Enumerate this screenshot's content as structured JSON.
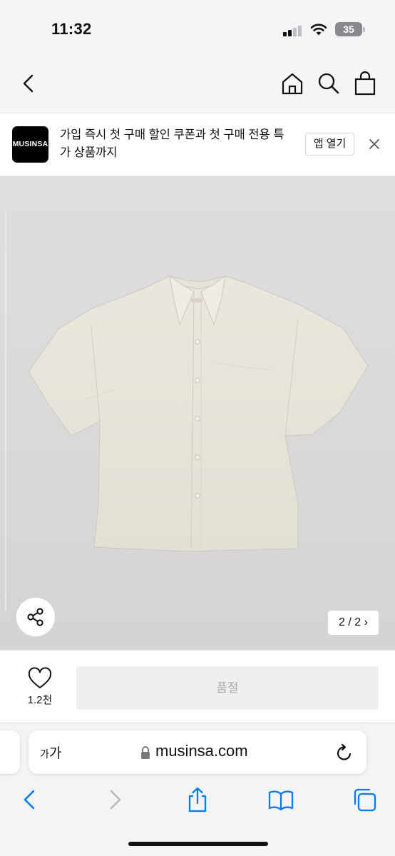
{
  "status_bar": {
    "time": "11:32",
    "battery": "35"
  },
  "header": {
    "icons": [
      "back-chevron-icon",
      "home-icon",
      "search-icon",
      "shopping-bag-icon"
    ]
  },
  "app_banner": {
    "logo_text": "MUSINSA",
    "message_line1": "가입 즉시 첫 구매 할인 쿠폰과 첫 구매 전용 특",
    "message_line2": "가 상품까지",
    "open_app_label": "앱 열기"
  },
  "gallery": {
    "page_indicator": "2 / 2",
    "current": 2,
    "total": 2
  },
  "purchase_bar": {
    "like_count": "1.2천",
    "sold_out_label": "품절"
  },
  "browser": {
    "text_size_small": "가",
    "text_size_large": "가",
    "url": "musinsa.com"
  },
  "colors": {
    "accent": "#007aff",
    "brand": "#000000",
    "sold_out_bg": "#efefef",
    "sold_out_text": "#a8a8a8"
  }
}
